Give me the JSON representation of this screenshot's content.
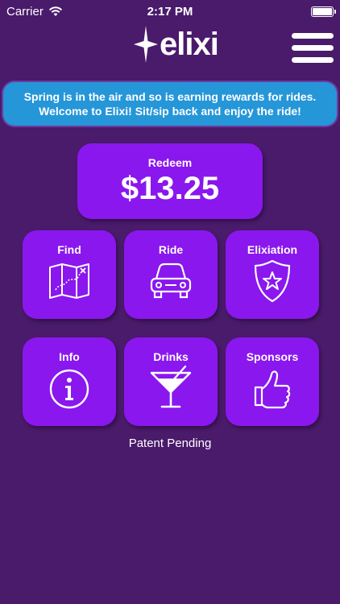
{
  "status_bar": {
    "carrier": "Carrier",
    "time": "2:17 PM",
    "wifi_icon": "wifi-icon",
    "battery_icon": "battery-icon"
  },
  "header": {
    "logo_text": "elixi",
    "logo_icon": "star-icon",
    "menu_icon": "hamburger-menu-icon"
  },
  "banner": {
    "line1": "Spring is in the air and so is earning rewards for rides.",
    "line2": "Welcome to Elixi! Sit/sip back and enjoy the ride!",
    "background_color": "#2596d8"
  },
  "redeem": {
    "label": "Redeem",
    "amount": "$13.25"
  },
  "tiles": [
    {
      "label": "Find",
      "icon": "map-icon"
    },
    {
      "label": "Ride",
      "icon": "car-icon"
    },
    {
      "label": "Elixiation",
      "icon": "shield-star-icon"
    },
    {
      "label": "Info",
      "icon": "info-icon"
    },
    {
      "label": "Drinks",
      "icon": "martini-icon"
    },
    {
      "label": "Sponsors",
      "icon": "thumbs-up-icon"
    }
  ],
  "footer": {
    "patent_text": "Patent Pending"
  },
  "colors": {
    "background": "#4a1a6b",
    "tile": "#8a17ee",
    "banner": "#2596d8"
  }
}
